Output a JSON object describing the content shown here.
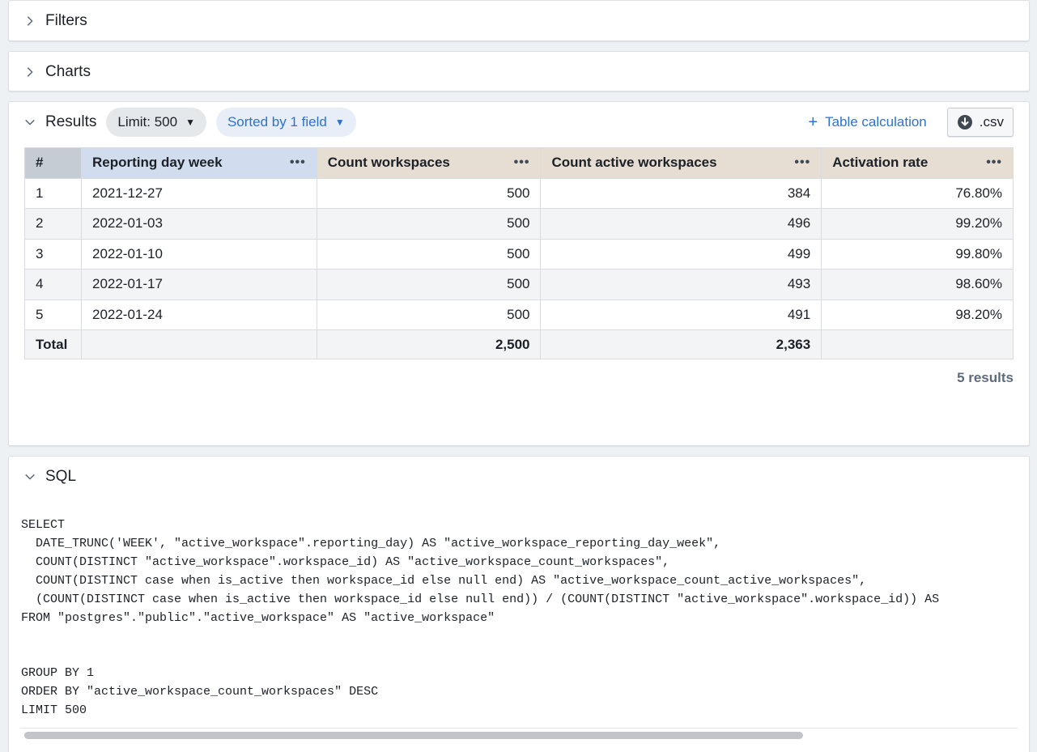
{
  "filters": {
    "title": "Filters"
  },
  "charts": {
    "title": "Charts"
  },
  "results": {
    "title": "Results",
    "limit_label": "Limit: 500",
    "sort_label": "Sorted by 1 field",
    "table_calc_label": "Table calculation",
    "csv_label": ".csv",
    "columns": {
      "index": "#",
      "dim": "Reporting day week",
      "c1": "Count workspaces",
      "c2": "Count active workspaces",
      "c3": "Activation rate"
    },
    "rows": [
      {
        "index": "1",
        "week": "2021-12-27",
        "count": "500",
        "active": "384",
        "rate": "76.80%"
      },
      {
        "index": "2",
        "week": "2022-01-03",
        "count": "500",
        "active": "496",
        "rate": "99.20%"
      },
      {
        "index": "3",
        "week": "2022-01-10",
        "count": "500",
        "active": "499",
        "rate": "99.80%"
      },
      {
        "index": "4",
        "week": "2022-01-17",
        "count": "500",
        "active": "493",
        "rate": "98.60%"
      },
      {
        "index": "5",
        "week": "2022-01-24",
        "count": "500",
        "active": "491",
        "rate": "98.20%"
      }
    ],
    "total": {
      "label": "Total",
      "count": "2,500",
      "active": "2,363"
    },
    "count_label": "5 results"
  },
  "sql": {
    "title": "SQL",
    "code": "SELECT\n  DATE_TRUNC('WEEK', \"active_workspace\".reporting_day) AS \"active_workspace_reporting_day_week\",\n  COUNT(DISTINCT \"active_workspace\".workspace_id) AS \"active_workspace_count_workspaces\",\n  COUNT(DISTINCT case when is_active then workspace_id else null end) AS \"active_workspace_count_active_workspaces\",\n  (COUNT(DISTINCT case when is_active then workspace_id else null end)) / (COUNT(DISTINCT \"active_workspace\".workspace_id)) AS\nFROM \"postgres\".\"public\".\"active_workspace\" AS \"active_workspace\"\n\n\nGROUP BY 1\nORDER BY \"active_workspace_count_workspaces\" DESC\nLIMIT 500"
  }
}
